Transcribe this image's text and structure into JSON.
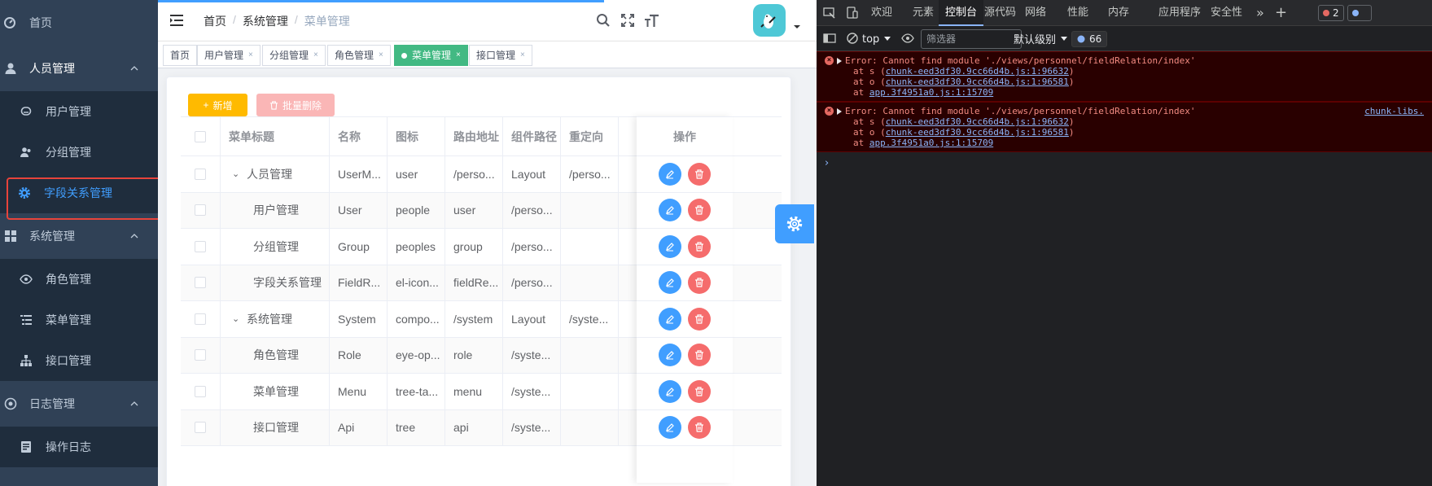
{
  "sidebar": {
    "top_item": "首页",
    "groups": [
      {
        "label": "人员管理",
        "items": [
          "用户管理",
          "分组管理",
          "字段关系管理"
        ]
      },
      {
        "label": "系统管理",
        "items": [
          "角色管理",
          "菜单管理",
          "接口管理"
        ]
      },
      {
        "label": "日志管理",
        "items": [
          "操作日志"
        ]
      }
    ],
    "active_item": "字段关系管理"
  },
  "navbar": {
    "breadcrumb": [
      "首页",
      "系统管理",
      "菜单管理"
    ]
  },
  "tags": [
    {
      "label": "首页",
      "closable": false
    },
    {
      "label": "用户管理",
      "closable": true
    },
    {
      "label": "分组管理",
      "closable": true
    },
    {
      "label": "角色管理",
      "closable": true
    },
    {
      "label": "菜单管理",
      "closable": true,
      "active": true
    },
    {
      "label": "接口管理",
      "closable": true
    }
  ],
  "toolbar": {
    "add_label": "新增",
    "batch_delete_label": "批量删除"
  },
  "table": {
    "columns": [
      "菜单标题",
      "名称",
      "图标",
      "路由地址",
      "组件路径",
      "重定向",
      "操作"
    ],
    "rows": [
      {
        "title": "人员管理",
        "name": "UserM...",
        "icon": "user",
        "path": "/perso...",
        "component": "Layout",
        "redirect": "/perso...",
        "level": 0
      },
      {
        "title": "用户管理",
        "name": "User",
        "icon": "people",
        "path": "user",
        "component": "/perso...",
        "redirect": "",
        "level": 1
      },
      {
        "title": "分组管理",
        "name": "Group",
        "icon": "peoples",
        "path": "group",
        "component": "/perso...",
        "redirect": "",
        "level": 1
      },
      {
        "title": "字段关系管理",
        "name": "FieldR...",
        "icon": "el-icon...",
        "path": "fieldRe...",
        "component": "/perso...",
        "redirect": "",
        "level": 1
      },
      {
        "title": "系统管理",
        "name": "System",
        "icon": "compo...",
        "path": "/system",
        "component": "Layout",
        "redirect": "/syste...",
        "level": 0
      },
      {
        "title": "角色管理",
        "name": "Role",
        "icon": "eye-op...",
        "path": "role",
        "component": "/syste...",
        "redirect": "",
        "level": 1
      },
      {
        "title": "菜单管理",
        "name": "Menu",
        "icon": "tree-ta...",
        "path": "menu",
        "component": "/syste...",
        "redirect": "",
        "level": 1
      },
      {
        "title": "接口管理",
        "name": "Api",
        "icon": "tree",
        "path": "api",
        "component": "/syste...",
        "redirect": "",
        "level": 1
      }
    ]
  },
  "devtools": {
    "tabs": [
      "欢迎",
      "元素",
      "控制台",
      "源代码",
      "网络",
      "性能",
      "内存",
      "应用程序",
      "安全性"
    ],
    "active_tab": "控制台",
    "error_count": "2",
    "context": "top",
    "filter_placeholder": "筛选器",
    "level": "默认级别",
    "issues_count": "66",
    "errors": [
      {
        "message": "Error: Cannot find module './views/personnel/fieldRelation/index'",
        "trace": [
          {
            "prefix": "at s (",
            "link": "chunk-eed3df30.9cc66d4b.js:1:96632",
            "suffix": ")"
          },
          {
            "prefix": "at o (",
            "link": "chunk-eed3df30.9cc66d4b.js:1:96581",
            "suffix": ")"
          },
          {
            "prefix": "at ",
            "link": "app.3f4951a0.js:1:15709",
            "suffix": ""
          }
        ],
        "source": ""
      },
      {
        "message": "Error: Cannot find module './views/personnel/fieldRelation/index'",
        "trace": [
          {
            "prefix": "at s (",
            "link": "chunk-eed3df30.9cc66d4b.js:1:96632",
            "suffix": ")"
          },
          {
            "prefix": "at o (",
            "link": "chunk-eed3df30.9cc66d4b.js:1:96581",
            "suffix": ")"
          },
          {
            "prefix": "at ",
            "link": "app.3f4951a0.js:1:15709",
            "suffix": ""
          }
        ],
        "source": "chunk-libs."
      }
    ],
    "prompt": "›"
  },
  "colors": {
    "sidebar_bg": "#304156",
    "sidebar_sub_bg": "#1f2d3d",
    "active_blue": "#409eff",
    "tag_active_green": "#42b983",
    "add_button": "#ffba00",
    "batch_delete_button": "#fab6b6",
    "delete_red": "#f56c6c",
    "highlight_box": "#e7433b",
    "devtools_bg": "#202124",
    "error_bg": "#290000"
  },
  "icons": [
    "dashboard-icon",
    "user-icon",
    "chevron-up-icon",
    "peoples-icon",
    "gear-icon",
    "grid-icon",
    "eye-icon",
    "tree-table-icon",
    "tree-icon",
    "log-icon",
    "document-icon",
    "hamburger-icon",
    "search-icon",
    "fullscreen-icon",
    "font-size-icon",
    "edit-icon",
    "delete-icon"
  ]
}
